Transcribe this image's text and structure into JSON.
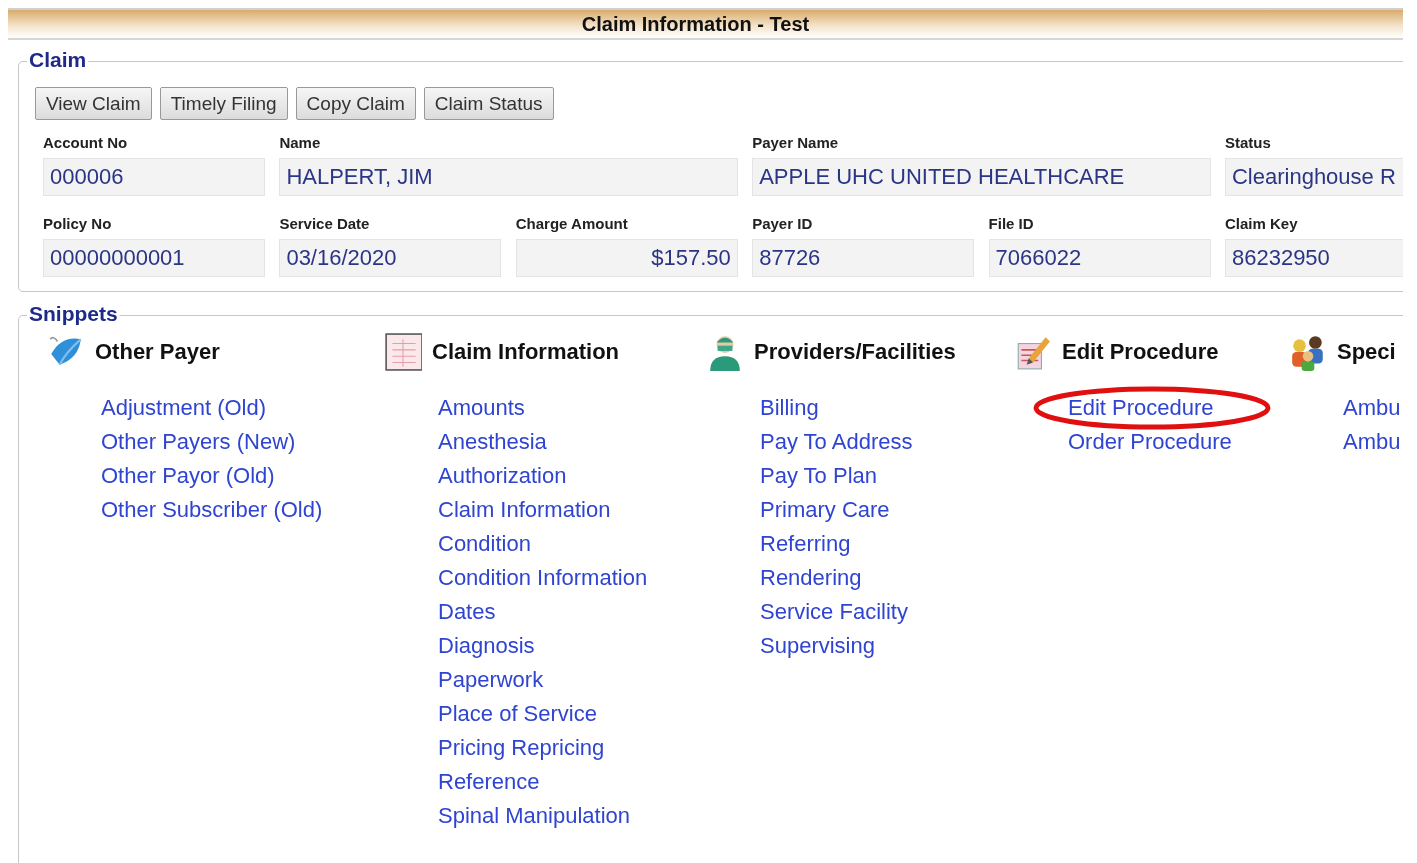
{
  "window": {
    "title": "Claim Information - Test"
  },
  "claim": {
    "legend": "Claim",
    "buttons": [
      "View Claim",
      "Timely Filing",
      "Copy Claim",
      "Claim Status"
    ],
    "fields": [
      {
        "label": "Account No",
        "value": "000006",
        "kind": "text"
      },
      {
        "label": "Name",
        "value": "HALPERT, JIM",
        "kind": "wide"
      },
      {
        "label": "Payer Name",
        "value": "APPLE UHC UNITED HEALTHCARE",
        "kind": "wide"
      },
      {
        "label": "Status",
        "value": "Clearinghouse R",
        "kind": "text"
      },
      {
        "label": "Policy No",
        "value": "00000000001",
        "kind": "text"
      },
      {
        "label": "Service Date",
        "value": "03/16/2020",
        "kind": "text"
      },
      {
        "label": "Charge Amount",
        "value": "$157.50",
        "kind": "amount"
      },
      {
        "label": "Payer ID",
        "value": "87726",
        "kind": "text"
      },
      {
        "label": "File ID",
        "value": "7066022",
        "kind": "text"
      },
      {
        "label": "Claim Key",
        "value": "86232950",
        "kind": "text"
      }
    ]
  },
  "snippets": {
    "legend": "Snippets",
    "groups": [
      {
        "title": "Other Payer",
        "links": [
          {
            "label": "Adjustment (Old)",
            "highlighted": false
          },
          {
            "label": "Other Payers (New)",
            "highlighted": false
          },
          {
            "label": "Other Payor (Old)",
            "highlighted": false
          },
          {
            "label": "Other Subscriber (Old)",
            "highlighted": false
          }
        ]
      },
      {
        "title": "Claim Information",
        "links": [
          {
            "label": "Amounts",
            "highlighted": false
          },
          {
            "label": "Anesthesia",
            "highlighted": false
          },
          {
            "label": "Authorization",
            "highlighted": false
          },
          {
            "label": "Claim Information",
            "highlighted": false
          },
          {
            "label": "Condition",
            "highlighted": false
          },
          {
            "label": "Condition Information",
            "highlighted": false
          },
          {
            "label": "Dates",
            "highlighted": false
          },
          {
            "label": "Diagnosis",
            "highlighted": false
          },
          {
            "label": "Paperwork",
            "highlighted": false
          },
          {
            "label": "Place of Service",
            "highlighted": false
          },
          {
            "label": "Pricing Repricing",
            "highlighted": false
          },
          {
            "label": "Reference",
            "highlighted": false
          },
          {
            "label": "Spinal Manipulation",
            "highlighted": false
          }
        ]
      },
      {
        "title": "Providers/Facilities",
        "links": [
          {
            "label": "Billing",
            "highlighted": false
          },
          {
            "label": "Pay To Address",
            "highlighted": false
          },
          {
            "label": "Pay To Plan",
            "highlighted": false
          },
          {
            "label": "Primary Care",
            "highlighted": false
          },
          {
            "label": "Referring",
            "highlighted": false
          },
          {
            "label": "Rendering",
            "highlighted": false
          },
          {
            "label": "Service Facility",
            "highlighted": false
          },
          {
            "label": "Supervising",
            "highlighted": false
          }
        ]
      },
      {
        "title": "Edit Procedure",
        "links": [
          {
            "label": "Edit Procedure",
            "highlighted": true
          },
          {
            "label": "Order Procedure",
            "highlighted": false
          }
        ]
      },
      {
        "title": "Speci",
        "links": [
          {
            "label": "Ambu",
            "highlighted": false
          },
          {
            "label": "Ambu",
            "highlighted": false
          }
        ]
      }
    ]
  }
}
